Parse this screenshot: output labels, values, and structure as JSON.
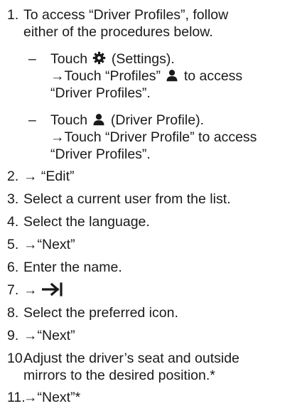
{
  "steps": [
    {
      "num": "1.",
      "lines": [
        "To access “Driver Profiles”, follow",
        "either of the procedures below."
      ],
      "substeps": [
        {
          "dash": "–",
          "line1_a": "Touch",
          "line1_icon": "gear-icon",
          "line1_b": "(Settings).",
          "line2_a": "→Touch “Profiles”",
          "line2_icon": "person-icon",
          "line2_b": "to access",
          "line3": "“Driver Profiles”."
        },
        {
          "dash": "–",
          "line1_a": "Touch",
          "line1_icon": "person-icon",
          "line1_b": "(Driver Profile).",
          "line2": "→Touch “Driver Profile” to access",
          "line3": "“Driver Profiles”."
        }
      ]
    },
    {
      "num": "2.",
      "text": "→ “Edit”"
    },
    {
      "num": "3.",
      "text": "Select a current user from the list."
    },
    {
      "num": "4.",
      "text": "Select the language."
    },
    {
      "num": "5.",
      "text": "→“Next”"
    },
    {
      "num": "6.",
      "text": "Enter the name."
    },
    {
      "num": "7.",
      "text": "→",
      "icon": "tab-arrow-icon"
    },
    {
      "num": "8.",
      "text": "Select the preferred icon."
    },
    {
      "num": "9.",
      "text": "→“Next”"
    },
    {
      "num": "10.",
      "lines": [
        "Adjust the driver’s seat and outside",
        "mirrors to the desired position.*"
      ]
    },
    {
      "num": "11.",
      "text": "→“Next”*"
    }
  ]
}
